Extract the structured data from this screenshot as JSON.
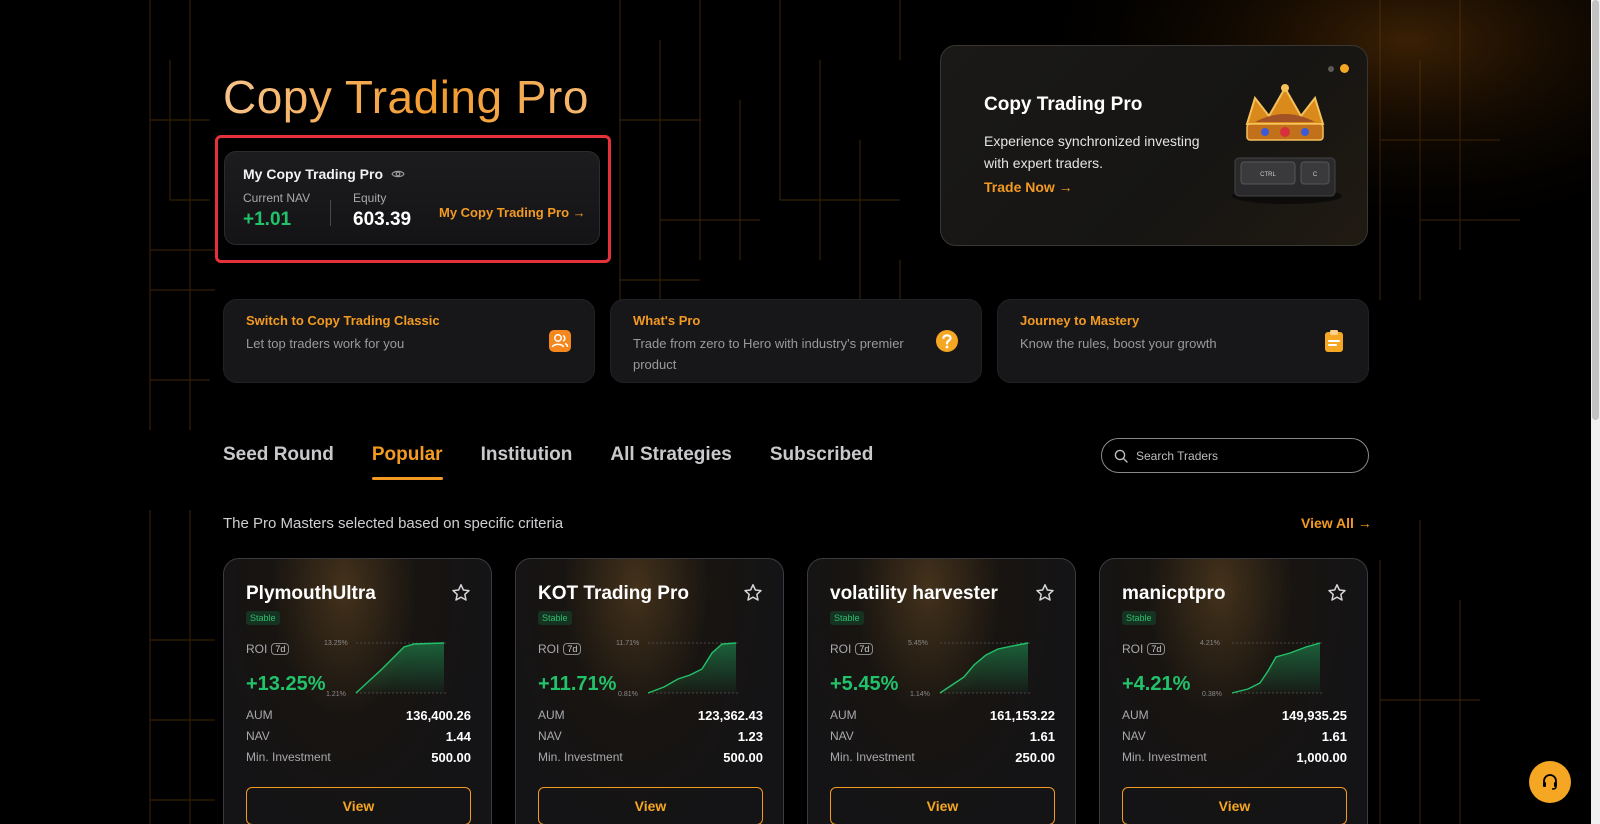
{
  "hero": {
    "title": "Copy Trading Pro"
  },
  "nav_card": {
    "title": "My Copy Trading Pro",
    "nav_label": "Current NAV",
    "nav_value": "+1.01",
    "equity_label": "Equity",
    "equity_value": "603.39",
    "link_label": "My Copy Trading Pro →"
  },
  "banner": {
    "title": "Copy Trading Pro",
    "description": "Experience synchronized investing with expert traders.",
    "link_label": "Trade Now →",
    "key_labels": [
      "CTRL",
      "C"
    ]
  },
  "features": [
    {
      "title": "Switch to Copy Trading Classic",
      "desc": "Let top traders work for you",
      "icon": "users-icon"
    },
    {
      "title": "What's Pro",
      "desc": "Trade from zero to Hero with industry's premier product",
      "icon": "question-icon"
    },
    {
      "title": "Journey to Mastery",
      "desc": "Know the rules, boost your growth",
      "icon": "clipboard-icon"
    }
  ],
  "tabs": [
    "Seed Round",
    "Popular",
    "Institution",
    "All Strategies",
    "Subscribed"
  ],
  "active_tab": "Popular",
  "search": {
    "placeholder": "Search Traders"
  },
  "section": {
    "subtitle": "The Pro Masters selected based on specific criteria",
    "view_all": "View All →"
  },
  "cards": [
    {
      "name": "PlymouthUltra",
      "badge": "Stable",
      "roi_label": "ROI",
      "period": "7d",
      "roi": "+13.25%",
      "chart_max": "13.25%",
      "chart_min": "1.21%",
      "aum": "136,400.26",
      "nav": "1.44",
      "min_investment": "500.00",
      "view": "View"
    },
    {
      "name": "KOT Trading Pro",
      "badge": "Stable",
      "roi_label": "ROI",
      "period": "7d",
      "roi": "+11.71%",
      "chart_max": "11.71%",
      "chart_min": "0.81%",
      "aum": "123,362.43",
      "nav": "1.23",
      "min_investment": "500.00",
      "view": "View"
    },
    {
      "name": "volatility harvester",
      "badge": "Stable",
      "roi_label": "ROI",
      "period": "7d",
      "roi": "+5.45%",
      "chart_max": "5.45%",
      "chart_min": "1.14%",
      "aum": "161,153.22",
      "nav": "1.61",
      "min_investment": "250.00",
      "view": "View"
    },
    {
      "name": "manicptpro",
      "badge": "Stable",
      "roi_label": "ROI",
      "period": "7d",
      "roi": "+4.21%",
      "chart_max": "4.21%",
      "chart_min": "0.38%",
      "aum": "149,935.25",
      "nav": "1.61",
      "min_investment": "1,000.00",
      "view": "View"
    }
  ],
  "card_labels": {
    "aum": "AUM",
    "nav": "NAV",
    "min_investment": "Min. Investment"
  },
  "colors": {
    "accent": "#f39a22",
    "positive": "#22c26b",
    "highlight": "#e5323a"
  }
}
